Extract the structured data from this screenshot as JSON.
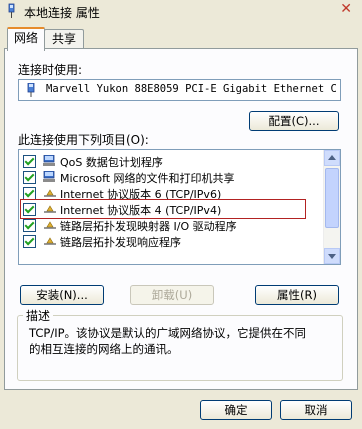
{
  "window": {
    "title": "本地连接 属性",
    "close_glyph": "✕"
  },
  "tabs": [
    {
      "label": "网络",
      "active": true
    },
    {
      "label": "共享",
      "active": false
    }
  ],
  "connect_using": {
    "label": "连接时使用:",
    "adapter": "Marvell Yukon 88E8059 PCI-E Gigabit Ethernet C",
    "configure_button": "配置(C)..."
  },
  "items_section": {
    "label": "此连接使用下列项目(O):",
    "items": [
      {
        "text": "QoS 数据包计划程序",
        "checked": true,
        "icon": "network-client-icon"
      },
      {
        "text": "Microsoft 网络的文件和打印机共享",
        "checked": true,
        "icon": "network-client-icon"
      },
      {
        "text": "Internet 协议版本 6 (TCP/IPv6)",
        "checked": true,
        "icon": "protocol-icon"
      },
      {
        "text": "Internet 协议版本 4 (TCP/IPv4)",
        "checked": true,
        "icon": "protocol-icon",
        "highlighted": true
      },
      {
        "text": "链路层拓扑发现映射器 I/O 驱动程序",
        "checked": true,
        "icon": "protocol-icon"
      },
      {
        "text": "链路层拓扑发现响应程序",
        "checked": true,
        "icon": "protocol-icon"
      }
    ]
  },
  "actions": {
    "install": "安装(N)...",
    "uninstall": "卸载(U)",
    "properties": "属性(R)"
  },
  "description": {
    "label": "描述",
    "line1": "TCP/IP。该协议是默认的广域网络协议，它提供在不同",
    "line2": "的相互连接的网络上的通讯。"
  },
  "footer": {
    "ok": "确定",
    "cancel": "取消"
  },
  "colors": {
    "highlight_border": "#b22222",
    "tab_accent": "#e68b2c"
  }
}
